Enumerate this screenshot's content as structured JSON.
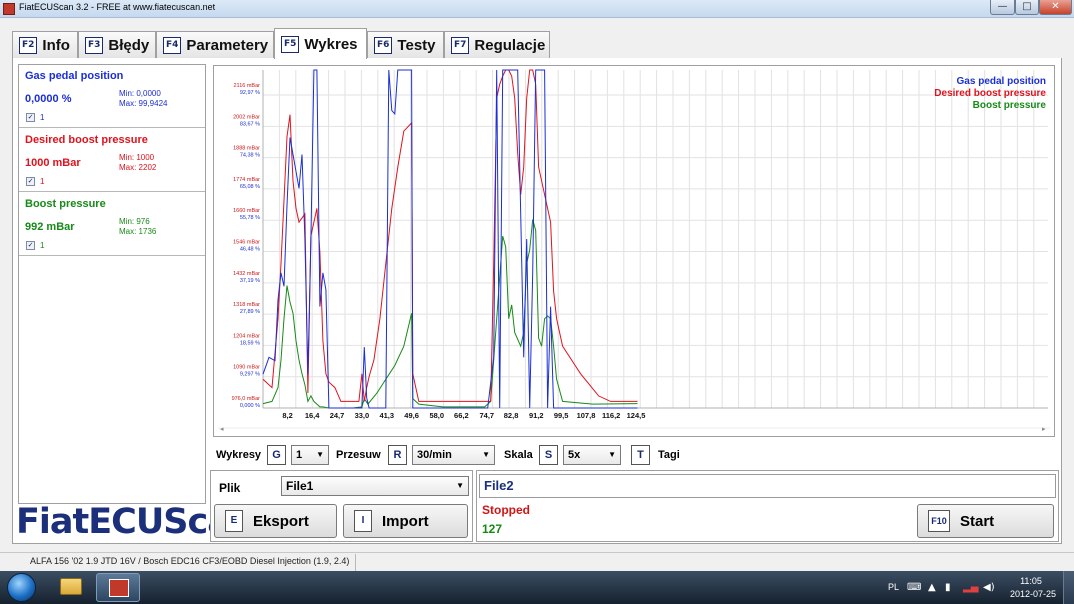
{
  "window": {
    "title": "FiatECUScan 3.2 - FREE at www.fiatecuscan.net",
    "min_label": "—",
    "max_label": "□",
    "close_label": "✕"
  },
  "tabs": [
    {
      "key": "F2",
      "label": "Info",
      "active": false
    },
    {
      "key": "F3",
      "label": "Błędy",
      "active": false
    },
    {
      "key": "F4",
      "label": "Parametery",
      "active": false
    },
    {
      "key": "F5",
      "label": "Wykres",
      "active": true
    },
    {
      "key": "F6",
      "label": "Testy",
      "active": false
    },
    {
      "key": "F7",
      "label": "Regulacje",
      "active": false
    }
  ],
  "sensors": [
    {
      "name": "Gas pedal position",
      "value": "0,0000 %",
      "min": "Min: 0,0000",
      "max": "Max: 99,9424",
      "checked": true,
      "check_label": "1",
      "color": "#1b2fd4"
    },
    {
      "name": "Desired boost pressure",
      "value": "1000 mBar",
      "min": "Min: 1000",
      "max": "Max: 2202",
      "checked": true,
      "check_label": "1",
      "color": "#e0121d"
    },
    {
      "name": "Boost pressure",
      "value": "992 mBar",
      "min": "Min: 976",
      "max": "Max: 1736",
      "checked": true,
      "check_label": "1",
      "color": "#178a17"
    }
  ],
  "logo": "FiatECUScan",
  "chart_data": {
    "type": "line",
    "legend_position": "top-right",
    "grid": true,
    "x_ticks": [
      "8,2",
      "16,4",
      "24,7",
      "33,0",
      "41,3",
      "49,6",
      "58,0",
      "66,2",
      "74,7",
      "82,8",
      "91,2",
      "99,5",
      "107,8",
      "116,2",
      "124,5"
    ],
    "y_ticks_mbar": [
      "976,0 mBar",
      "1090 mBar",
      "1204 mBar",
      "1318 mBar",
      "1432 mBar",
      "1546 mBar",
      "1660 mBar",
      "1774 mBar",
      "1888 mBar",
      "2002 mBar",
      "2116 mBar"
    ],
    "y_ticks_percent": [
      "0,000 %",
      "9,297 %",
      "18,59 %",
      "27,89 %",
      "37,19 %",
      "46,48 %",
      "55,78 %",
      "65,08 %",
      "74,38 %",
      "83,67 %",
      "92,97 %"
    ],
    "xlim": [
      0,
      262
    ],
    "ylim_mbar": [
      976,
      2202
    ],
    "series": [
      {
        "name": "Gas pedal position",
        "unit": "%",
        "color": "#1b2fd4",
        "x": [
          0,
          2,
          4,
          5,
          6,
          7,
          8,
          9,
          10,
          11,
          12,
          13,
          14,
          15,
          16,
          17,
          18,
          19,
          20,
          21,
          22,
          24,
          26,
          28,
          30,
          32,
          33,
          33.8,
          34.6,
          35.4,
          38,
          41,
          42,
          43,
          44,
          45,
          47,
          49.6,
          50,
          51,
          52,
          60,
          70,
          74,
          75,
          77,
          78,
          79,
          80,
          81,
          82,
          83,
          85,
          87,
          88,
          89,
          90,
          91,
          92,
          93,
          94,
          95,
          96,
          97,
          98,
          99,
          100,
          120,
          125
        ],
        "y": [
          10,
          15,
          14,
          32,
          40,
          36,
          60,
          80,
          75,
          70,
          65,
          75,
          50,
          10,
          50,
          100,
          100,
          30,
          40,
          35,
          0,
          0,
          0,
          0,
          0,
          0,
          0,
          18,
          3,
          0,
          0,
          0,
          100,
          88,
          87,
          100,
          100,
          100,
          0,
          0,
          0,
          0,
          0,
          0,
          0,
          15,
          100,
          0,
          100,
          100,
          100,
          100,
          100,
          15,
          50,
          0,
          40,
          100,
          100,
          100,
          100,
          0,
          30,
          0,
          0,
          0,
          0,
          0,
          0
        ]
      },
      {
        "name": "Desired boost pressure",
        "unit": "mBar",
        "color": "#e0121d",
        "x": [
          0,
          3,
          5,
          6,
          8,
          9,
          10,
          11,
          12,
          14,
          15,
          16,
          17,
          18,
          19,
          20,
          21,
          22,
          24,
          26,
          28,
          30,
          32,
          33,
          33.8,
          34.6,
          35.4,
          37,
          39,
          41,
          43,
          45,
          47,
          49.6,
          50,
          51,
          52,
          56,
          60,
          70,
          74,
          76,
          77,
          78,
          79,
          80,
          81,
          82,
          83,
          84,
          85,
          86,
          87,
          88,
          89,
          90,
          91,
          92,
          93,
          94,
          95,
          96,
          97,
          98,
          99,
          100,
          103,
          106,
          109,
          112,
          116,
          120,
          125
        ],
        "y": [
          1080,
          1050,
          1300,
          1500,
          1960,
          2040,
          1800,
          1700,
          1650,
          1680,
          1030,
          1600,
          1650,
          1700,
          1540,
          1220,
          1100,
          1070,
          1050,
          1000,
          1000,
          1000,
          1000,
          1100,
          1000,
          1050,
          1090,
          1150,
          1300,
          1500,
          1700,
          1850,
          1980,
          2010,
          1100,
          1050,
          1000,
          1000,
          1000,
          1000,
          1000,
          1000,
          1500,
          2100,
          2150,
          2180,
          2202,
          2202,
          2180,
          2100,
          1900,
          1750,
          1850,
          2100,
          2202,
          2202,
          2150,
          1850,
          1800,
          1750,
          1700,
          1650,
          1400,
          1300,
          1250,
          1200,
          1150,
          1100,
          1060,
          1020,
          1000,
          1000,
          1000
        ]
      },
      {
        "name": "Boost pressure",
        "unit": "mBar",
        "color": "#178a17",
        "x": [
          0,
          3,
          5,
          6,
          7,
          8,
          9,
          10,
          11,
          12,
          13,
          14,
          15,
          16,
          17,
          18,
          19,
          20,
          22,
          26,
          30,
          33,
          33.8,
          35,
          38,
          41,
          44,
          47,
          49.6,
          50,
          52,
          60,
          70,
          74,
          76,
          77,
          78,
          79,
          80,
          81,
          82,
          83,
          84,
          86,
          87,
          88,
          89,
          90,
          91,
          92,
          93,
          94,
          95,
          96,
          97,
          98,
          100,
          110,
          125
        ],
        "y": [
          992,
          1000,
          1050,
          1150,
          1300,
          1420,
          1360,
          1320,
          1220,
          1150,
          1100,
          1060,
          1000,
          1020,
          1000,
          990,
          980,
          980,
          976,
          976,
          976,
          980,
          1010,
          990,
          1030,
          1080,
          1130,
          1200,
          1320,
          1010,
          990,
          980,
          980,
          980,
          1000,
          1150,
          1300,
          1450,
          1600,
          1560,
          1300,
          1350,
          1250,
          1200,
          1250,
          1500,
          1550,
          1660,
          1620,
          1230,
          1200,
          1300,
          1310,
          1300,
          1200,
          1080,
          1000,
          990,
          992
        ]
      }
    ]
  },
  "controls": {
    "wykresy_label": "Wykresy",
    "wykresy_key": "G",
    "wykresy_value": "1",
    "przesuw_label": "Przesuw",
    "przesuw_key": "R",
    "przesuw_value": "30/min",
    "skala_label": "Skala",
    "skala_key": "S",
    "skala_value": "5x",
    "tagi_key": "T",
    "tagi_label": "Tagi",
    "dropdown_arrow": "▼"
  },
  "plik": {
    "label": "Plik",
    "value": "File1",
    "eksport_key": "E",
    "eksport_label": "Eksport",
    "import_key": "I",
    "import_label": "Import"
  },
  "file2": {
    "name": "File2",
    "status": "Stopped",
    "count": "127",
    "start_key": "F10",
    "start_label": "Start"
  },
  "statusbar": {
    "text": "ALFA 156 '02 1.9 JTD 16V / Bosch EDC16 CF3/EOBD Diesel Injection (1.9, 2.4)"
  },
  "taskbar": {
    "lang": "PL",
    "time": "11:05",
    "date": "2012-07-25"
  }
}
